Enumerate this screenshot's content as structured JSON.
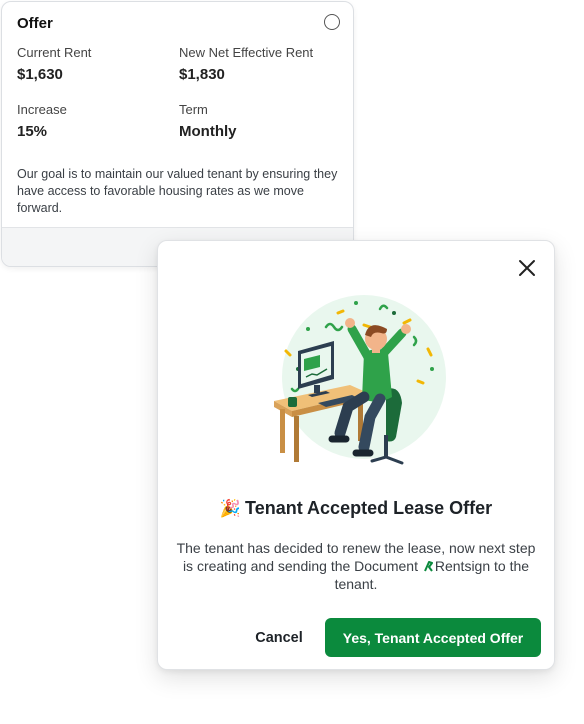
{
  "offer_card": {
    "title": "Offer",
    "current_rent_label": "Current Rent",
    "current_rent_value": "$1,630",
    "new_rent_label": "New Net Effective Rent",
    "new_rent_value": "$1,830",
    "increase_label": "Increase",
    "increase_value": "15%",
    "term_label": "Term",
    "term_value": "Monthly",
    "description": "Our goal is to maintain our valued tenant by ensuring they have access to favorable housing rates as we move forward.",
    "footer_icons": [
      "pencil-icon",
      "trash-icon"
    ]
  },
  "modal": {
    "title_emoji": "🎉",
    "title": "Tenant Accepted Lease Offer",
    "body_before": "The tenant has decided to renew the lease, now next step is creating and sending the Document",
    "brand": "Rentsign",
    "body_after": "to the tenant.",
    "cancel_label": "Cancel",
    "confirm_label": "Yes, Tenant Accepted Offer",
    "close_icon": "close-icon",
    "illustration": "celebrating-person-at-desk"
  },
  "colors": {
    "primary": "#0b8a3d",
    "accent_green": "#2fa24a",
    "card_border": "#dcdfe3",
    "footer_bg": "#f4f5f6"
  }
}
